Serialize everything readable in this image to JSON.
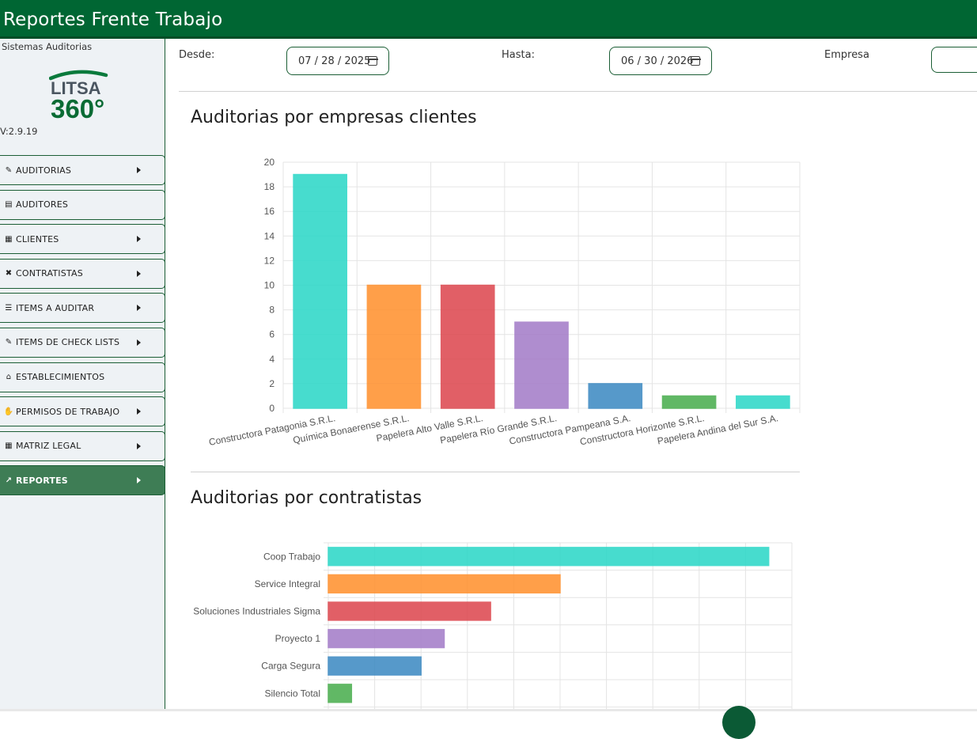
{
  "header": {
    "title": "Reportes Frente Trabajo"
  },
  "sidebar": {
    "system_label": "Sistemas Auditorias",
    "logo": {
      "line1": "LITSA",
      "line2": "360°"
    },
    "version": "V:2.9.19",
    "items": [
      {
        "label": "AUDITORIAS",
        "icon": "edit-icon",
        "glyph": "✎",
        "has_caret": true,
        "active": false
      },
      {
        "label": "AUDITORES",
        "icon": "id-card-icon",
        "glyph": "▤",
        "has_caret": false,
        "active": false
      },
      {
        "label": "CLIENTES",
        "icon": "building-icon",
        "glyph": "▦",
        "has_caret": true,
        "active": false
      },
      {
        "label": "CONTRATISTAS",
        "icon": "tools-icon",
        "glyph": "✖",
        "has_caret": true,
        "active": false
      },
      {
        "label": "ITEMS A AUDITAR",
        "icon": "list-check-icon",
        "glyph": "☰",
        "has_caret": true,
        "active": false
      },
      {
        "label": "ITEMS DE CHECK LISTS",
        "icon": "edit-icon",
        "glyph": "✎",
        "has_caret": true,
        "active": false
      },
      {
        "label": "ESTABLECIMIENTOS",
        "icon": "map-icon",
        "glyph": "⌂",
        "has_caret": false,
        "active": false
      },
      {
        "label": "PERMISOS DE TRABAJO",
        "icon": "hand-icon",
        "glyph": "✋",
        "has_caret": true,
        "active": false
      },
      {
        "label": "MATRIZ LEGAL",
        "icon": "table-icon",
        "glyph": "▦",
        "has_caret": true,
        "active": false
      },
      {
        "label": "REPORTES",
        "icon": "chart-line-icon",
        "glyph": "↗",
        "has_caret": true,
        "active": true
      }
    ]
  },
  "filters": {
    "desde_label": "Desde:",
    "desde_value": "07 / 28 / 2025",
    "hasta_label": "Hasta:",
    "hasta_value": "06 / 30 / 2026",
    "empresa_label": "Empresa",
    "empresa_value": ""
  },
  "chart_data": [
    {
      "type": "bar",
      "title": "Auditorias por empresas clientes",
      "categories": [
        "Constructora Patagonia S.R.L.",
        "Química Bonaerense S.R.L.",
        "Papelera Alto Valle S.R.L.",
        "Papelera Río Grande S.R.L.",
        "Constructora Pampeana S.A.",
        "Constructora Horizonte S.R.L.",
        "Papelera Andina del Sur S.A."
      ],
      "values": [
        19,
        10,
        10,
        7,
        2,
        1,
        1
      ],
      "colors": [
        "#2ed8c8",
        "#ff9231",
        "#dd4a51",
        "#a57ec9",
        "#3f8bc3",
        "#4caf50",
        "#2ed8c8"
      ],
      "ylim": [
        0,
        20
      ],
      "yticks": [
        "0",
        "2",
        "4",
        "6",
        "8",
        "10",
        "12",
        "14",
        "16",
        "18",
        "20"
      ],
      "grid": true,
      "legend": "none"
    },
    {
      "type": "bar",
      "orientation": "horizontal",
      "title": "Auditorias por contratistas",
      "categories": [
        "Coop Trabajo",
        "Service Integral",
        "Soluciones Industriales Sigma",
        "Proyecto 1",
        "Carga Segura",
        "Silencio Total"
      ],
      "values": [
        19,
        10,
        7,
        5,
        4,
        1
      ],
      "colors": [
        "#2ed8c8",
        "#ff9231",
        "#dd4a51",
        "#a57ec9",
        "#3f8bc3",
        "#4caf50"
      ],
      "xlim": [
        0,
        20
      ],
      "grid": true,
      "legend": "none"
    }
  ]
}
